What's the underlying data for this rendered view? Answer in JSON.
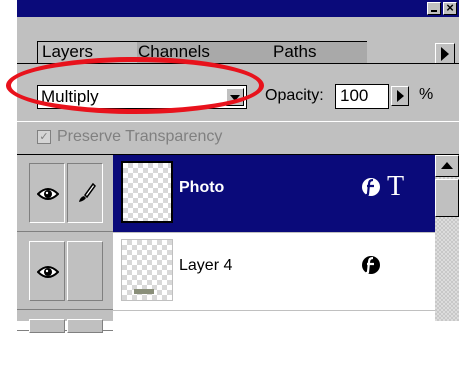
{
  "panel": {
    "tabs": [
      {
        "label": "Layers",
        "active": true
      },
      {
        "label": "Channels",
        "active": false
      },
      {
        "label": "Paths",
        "active": false
      }
    ]
  },
  "controls": {
    "blend_mode": "Multiply",
    "opacity_label": "Opacity:",
    "opacity_value": "100",
    "opacity_unit": "%",
    "preserve_transparency": {
      "label": "Preserve Transparency",
      "checked": true,
      "enabled": false
    }
  },
  "layers": [
    {
      "name": "Photo",
      "selected": true,
      "visible": true,
      "linked_brush": true,
      "has_effects": true,
      "text_layer_glyph": "T"
    },
    {
      "name": "Layer 4",
      "selected": false,
      "visible": true,
      "linked_brush": false,
      "has_effects": true
    }
  ],
  "colors": {
    "title_bar": "#0a0a7a",
    "selected_layer": "#0a0a7a",
    "highlight_ellipse": "#e8121c",
    "panel_gray": "#c0c0c0"
  },
  "icons": [
    "close-icon",
    "minimize-icon",
    "panel-menu-arrow-icon",
    "dropdown-arrow-icon",
    "eye-icon",
    "paintbrush-icon",
    "layer-effects-icon",
    "text-layer-icon",
    "scroll-up-arrow-icon"
  ]
}
